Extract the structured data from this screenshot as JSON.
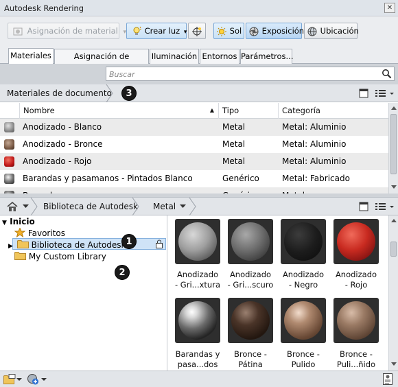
{
  "window": {
    "title": "Autodesk Rendering",
    "close_glyph": "✕"
  },
  "toolbar": {
    "assign_material": "Asignación de material",
    "create_light": "Crear luz",
    "sun": "Sol",
    "exposure": "Exposición",
    "location": "Ubicación",
    "dropdown_glyph": "▾"
  },
  "tabs": [
    "Materiales",
    "Asignación de materiales",
    "Iluminación",
    "Entornos",
    "Parámetros..."
  ],
  "search": {
    "placeholder": "Buscar"
  },
  "doc_breadcrumb": {
    "label": "Materiales de documento",
    "badge": "3"
  },
  "grid": {
    "columns": [
      "Nombre",
      "Tipo",
      "Categoría"
    ],
    "sort_glyph": "▲",
    "rows": [
      {
        "name": "Anodizado - Blanco",
        "type": "Metal",
        "category": "Metal: Aluminio",
        "swatch": "#9a9a9a"
      },
      {
        "name": "Anodizado - Bronce",
        "type": "Metal",
        "category": "Metal: Aluminio",
        "swatch": "#7a5a45"
      },
      {
        "name": "Anodizado - Rojo",
        "type": "Metal",
        "category": "Metal: Aluminio",
        "swatch": "#b01818"
      },
      {
        "name": "Barandas y pasamanos - Pintados Blanco",
        "type": "Genérico",
        "category": "Metal: Fabricado",
        "swatch": "#555555"
      },
      {
        "name": "Barandas y pasamanos - ...",
        "type": "Genérico",
        "category": "Metal: ...",
        "swatch": "#444444"
      }
    ]
  },
  "library_breadcrumb": {
    "items": [
      "Biblioteca de Autodesk",
      "Metal"
    ]
  },
  "tree": {
    "root": "Inicio",
    "favorites": "Favoritos",
    "autodesk_library": "Biblioteca de Autodesk",
    "custom_library": "My Custom Library",
    "badge1": "1",
    "badge2": "2",
    "expand_glyph": "▶",
    "collapse_glyph": "▼"
  },
  "thumbnails": [
    {
      "label_lines": [
        "Anodizado",
        "- Gri...xtura"
      ],
      "bg": "#2e2e2e",
      "sphere": "radial-gradient(circle at 38% 32%, #d8d8d8 0%, #9e9e9e 45%, #5a5a5a 80%, #3a3a3a 100%)"
    },
    {
      "label_lines": [
        "Anodizado",
        "- Gri...scuro"
      ],
      "bg": "#2e2e2e",
      "sphere": "radial-gradient(circle at 38% 32%, #a8a8a8 0%, #6e6e6e 45%, #3e3e3e 80%, #2a2a2a 100%)"
    },
    {
      "label_lines": [
        "Anodizado",
        "- Negro"
      ],
      "bg": "#2e2e2e",
      "sphere": "radial-gradient(circle at 38% 32%, #3c3c3c 0%, #1c1c1c 50%, #0a0a0a 100%)"
    },
    {
      "label_lines": [
        "Anodizado",
        "- Rojo"
      ],
      "bg": "#2e2e2e",
      "sphere": "radial-gradient(circle at 38% 32%, #f06a5a 0%, #c82a20 45%, #7a1010 85%, #4a0808 100%)"
    },
    {
      "label_lines": [
        "Barandas y",
        "pasa...dos"
      ],
      "bg": "#2e2e2e",
      "sphere": "radial-gradient(circle at 35% 28%, #ffffff 0%, #d8d8d8 15%, #6a6a6a 45%, #222222 75%, #8a8a8a 100%)"
    },
    {
      "label_lines": [
        "Bronce -",
        "Pátina"
      ],
      "bg": "#2e2e2e",
      "sphere": "radial-gradient(circle at 38% 30%, #9a8070 0%, #4a3428 35%, #22160f 75%, #3a2a20 100%)"
    },
    {
      "label_lines": [
        "Bronce -",
        "Pulido"
      ],
      "bg": "#2e2e2e",
      "sphere": "radial-gradient(circle at 38% 30%, #f2dccc 0%, #b08a70 30%, #6a4a36 70%, #3a281c 100%)"
    },
    {
      "label_lines": [
        "Bronce -",
        "Puli...ñido"
      ],
      "bg": "#2e2e2e",
      "sphere": "radial-gradient(circle at 38% 30%, #d8bca8 0%, #9a7a64 35%, #5e4434 75%, #3a281c 100%)"
    }
  ]
}
